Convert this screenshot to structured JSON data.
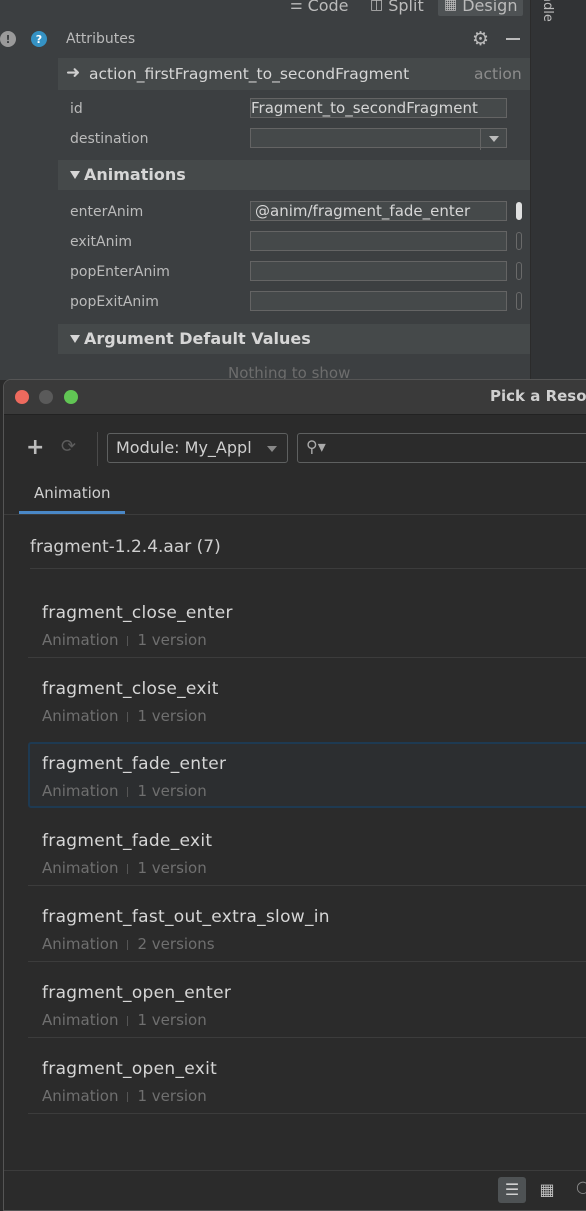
{
  "top_bar": {
    "modes": [
      {
        "label": "Code",
        "icon": "list-icon"
      },
      {
        "label": "Split",
        "icon": "split-icon"
      },
      {
        "label": "Design",
        "icon": "image-icon"
      }
    ],
    "side_tab": "adle"
  },
  "attributes": {
    "title": "Attributes",
    "action": {
      "name": "action_firstFragment_to_secondFragment",
      "type": "action"
    },
    "fields": {
      "id": {
        "label": "id",
        "value": "Fragment_to_secondFragment"
      },
      "destination": {
        "label": "destination",
        "value": ""
      }
    },
    "animations": {
      "header": "Animations",
      "enterAnim": {
        "label": "enterAnim",
        "value": "@anim/fragment_fade_enter"
      },
      "exitAnim": {
        "label": "exitAnim",
        "value": ""
      },
      "popEnterAnim": {
        "label": "popEnterAnim",
        "value": ""
      },
      "popExitAnim": {
        "label": "popExitAnim",
        "value": ""
      }
    },
    "argument_defaults": {
      "header": "Argument Default Values",
      "empty_text": "Nothing to show"
    }
  },
  "dialog": {
    "title": "Pick a Resou",
    "module_select": "Module: My_Appl",
    "search_placeholder": "",
    "tab": "Animation",
    "group": "fragment-1.2.4.aar (7)",
    "items": [
      {
        "name": "fragment_close_enter",
        "type": "Animation",
        "versions": "1 version",
        "selected": false
      },
      {
        "name": "fragment_close_exit",
        "type": "Animation",
        "versions": "1 version",
        "selected": false
      },
      {
        "name": "fragment_fade_enter",
        "type": "Animation",
        "versions": "1 version",
        "selected": true
      },
      {
        "name": "fragment_fade_exit",
        "type": "Animation",
        "versions": "1 version",
        "selected": false
      },
      {
        "name": "fragment_fast_out_extra_slow_in",
        "type": "Animation",
        "versions": "2 versions",
        "selected": false
      },
      {
        "name": "fragment_open_enter",
        "type": "Animation",
        "versions": "1 version",
        "selected": false
      },
      {
        "name": "fragment_open_exit",
        "type": "Animation",
        "versions": "1 version",
        "selected": false
      }
    ]
  },
  "colors": {
    "selection_border": "#1e3a52",
    "tab_underline": "#4a88c7",
    "close": "#ed6a5e",
    "maximize": "#61c554"
  }
}
